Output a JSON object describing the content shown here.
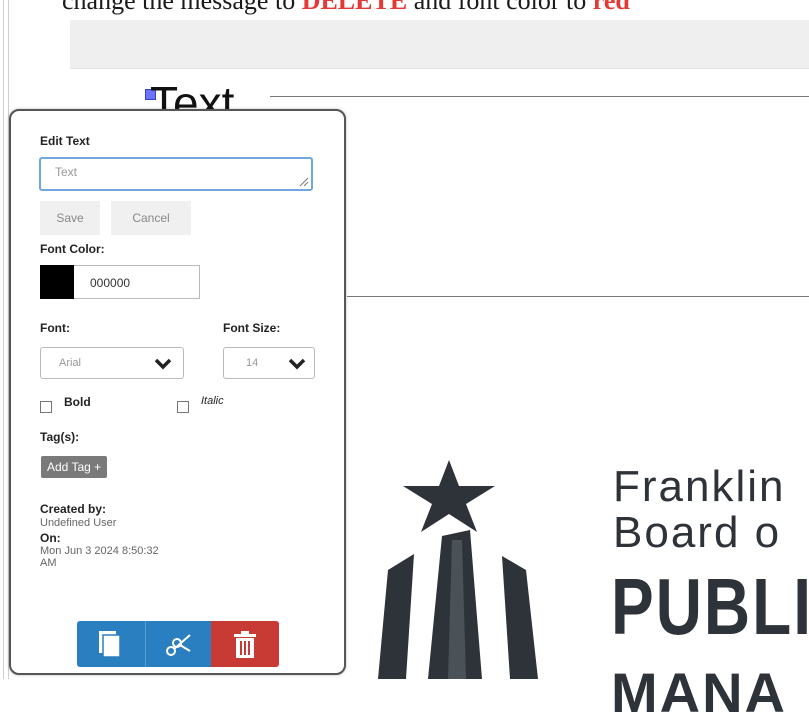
{
  "instruction": {
    "prefix": "change the message to ",
    "keyword": "DELETE",
    "middle": " and font color to ",
    "keyword2": "red"
  },
  "document": {
    "text": "Text",
    "brand_line1": "Franklin",
    "brand_line2": "Board o",
    "brand_line3": "PUBLI",
    "brand_line4": "MANA"
  },
  "panel": {
    "title": "Edit Text",
    "text_value": "Text",
    "save_label": "Save",
    "cancel_label": "Cancel",
    "font_color_label": "Font Color:",
    "font_color_hex": "000000",
    "font_label": "Font:",
    "font_value": "Arial",
    "font_size_label": "Font Size:",
    "font_size_value": "14",
    "bold_label": "Bold",
    "italic_label": "Italic",
    "tags_label": "Tag(s):",
    "add_tag_label": "Add Tag +",
    "created_by_label": "Created by:",
    "created_by_value": "Undefined User",
    "on_label": "On:",
    "on_value_line1": "Mon Jun 3 2024 8:50:32",
    "on_value_line2": "AM"
  },
  "actions": {
    "copy_icon": "copy-icon",
    "cut_icon": "scissors-icon",
    "delete_icon": "trash-icon"
  },
  "colors": {
    "accent_blue": "#2a7fc0",
    "danger_red": "#c83a34",
    "keyword_red": "#e53935",
    "logo_dark": "#2d3339"
  }
}
